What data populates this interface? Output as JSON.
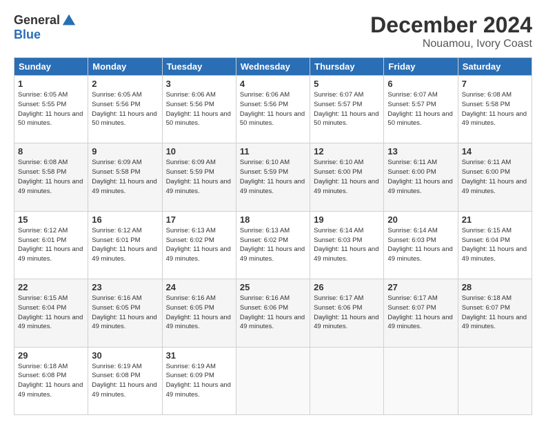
{
  "logo": {
    "general": "General",
    "blue": "Blue"
  },
  "title": "December 2024",
  "subtitle": "Nouamou, Ivory Coast",
  "days_header": [
    "Sunday",
    "Monday",
    "Tuesday",
    "Wednesday",
    "Thursday",
    "Friday",
    "Saturday"
  ],
  "weeks": [
    [
      {
        "day": "1",
        "sunrise": "6:05 AM",
        "sunset": "5:55 PM",
        "daylight": "11 hours and 50 minutes."
      },
      {
        "day": "2",
        "sunrise": "6:05 AM",
        "sunset": "5:56 PM",
        "daylight": "11 hours and 50 minutes."
      },
      {
        "day": "3",
        "sunrise": "6:06 AM",
        "sunset": "5:56 PM",
        "daylight": "11 hours and 50 minutes."
      },
      {
        "day": "4",
        "sunrise": "6:06 AM",
        "sunset": "5:56 PM",
        "daylight": "11 hours and 50 minutes."
      },
      {
        "day": "5",
        "sunrise": "6:07 AM",
        "sunset": "5:57 PM",
        "daylight": "11 hours and 50 minutes."
      },
      {
        "day": "6",
        "sunrise": "6:07 AM",
        "sunset": "5:57 PM",
        "daylight": "11 hours and 50 minutes."
      },
      {
        "day": "7",
        "sunrise": "6:08 AM",
        "sunset": "5:58 PM",
        "daylight": "11 hours and 49 minutes."
      }
    ],
    [
      {
        "day": "8",
        "sunrise": "6:08 AM",
        "sunset": "5:58 PM",
        "daylight": "11 hours and 49 minutes."
      },
      {
        "day": "9",
        "sunrise": "6:09 AM",
        "sunset": "5:58 PM",
        "daylight": "11 hours and 49 minutes."
      },
      {
        "day": "10",
        "sunrise": "6:09 AM",
        "sunset": "5:59 PM",
        "daylight": "11 hours and 49 minutes."
      },
      {
        "day": "11",
        "sunrise": "6:10 AM",
        "sunset": "5:59 PM",
        "daylight": "11 hours and 49 minutes."
      },
      {
        "day": "12",
        "sunrise": "6:10 AM",
        "sunset": "6:00 PM",
        "daylight": "11 hours and 49 minutes."
      },
      {
        "day": "13",
        "sunrise": "6:11 AM",
        "sunset": "6:00 PM",
        "daylight": "11 hours and 49 minutes."
      },
      {
        "day": "14",
        "sunrise": "6:11 AM",
        "sunset": "6:00 PM",
        "daylight": "11 hours and 49 minutes."
      }
    ],
    [
      {
        "day": "15",
        "sunrise": "6:12 AM",
        "sunset": "6:01 PM",
        "daylight": "11 hours and 49 minutes."
      },
      {
        "day": "16",
        "sunrise": "6:12 AM",
        "sunset": "6:01 PM",
        "daylight": "11 hours and 49 minutes."
      },
      {
        "day": "17",
        "sunrise": "6:13 AM",
        "sunset": "6:02 PM",
        "daylight": "11 hours and 49 minutes."
      },
      {
        "day": "18",
        "sunrise": "6:13 AM",
        "sunset": "6:02 PM",
        "daylight": "11 hours and 49 minutes."
      },
      {
        "day": "19",
        "sunrise": "6:14 AM",
        "sunset": "6:03 PM",
        "daylight": "11 hours and 49 minutes."
      },
      {
        "day": "20",
        "sunrise": "6:14 AM",
        "sunset": "6:03 PM",
        "daylight": "11 hours and 49 minutes."
      },
      {
        "day": "21",
        "sunrise": "6:15 AM",
        "sunset": "6:04 PM",
        "daylight": "11 hours and 49 minutes."
      }
    ],
    [
      {
        "day": "22",
        "sunrise": "6:15 AM",
        "sunset": "6:04 PM",
        "daylight": "11 hours and 49 minutes."
      },
      {
        "day": "23",
        "sunrise": "6:16 AM",
        "sunset": "6:05 PM",
        "daylight": "11 hours and 49 minutes."
      },
      {
        "day": "24",
        "sunrise": "6:16 AM",
        "sunset": "6:05 PM",
        "daylight": "11 hours and 49 minutes."
      },
      {
        "day": "25",
        "sunrise": "6:16 AM",
        "sunset": "6:06 PM",
        "daylight": "11 hours and 49 minutes."
      },
      {
        "day": "26",
        "sunrise": "6:17 AM",
        "sunset": "6:06 PM",
        "daylight": "11 hours and 49 minutes."
      },
      {
        "day": "27",
        "sunrise": "6:17 AM",
        "sunset": "6:07 PM",
        "daylight": "11 hours and 49 minutes."
      },
      {
        "day": "28",
        "sunrise": "6:18 AM",
        "sunset": "6:07 PM",
        "daylight": "11 hours and 49 minutes."
      }
    ],
    [
      {
        "day": "29",
        "sunrise": "6:18 AM",
        "sunset": "6:08 PM",
        "daylight": "11 hours and 49 minutes."
      },
      {
        "day": "30",
        "sunrise": "6:19 AM",
        "sunset": "6:08 PM",
        "daylight": "11 hours and 49 minutes."
      },
      {
        "day": "31",
        "sunrise": "6:19 AM",
        "sunset": "6:09 PM",
        "daylight": "11 hours and 49 minutes."
      },
      null,
      null,
      null,
      null
    ]
  ],
  "labels": {
    "sunrise": "Sunrise:",
    "sunset": "Sunset:",
    "daylight": "Daylight:"
  }
}
